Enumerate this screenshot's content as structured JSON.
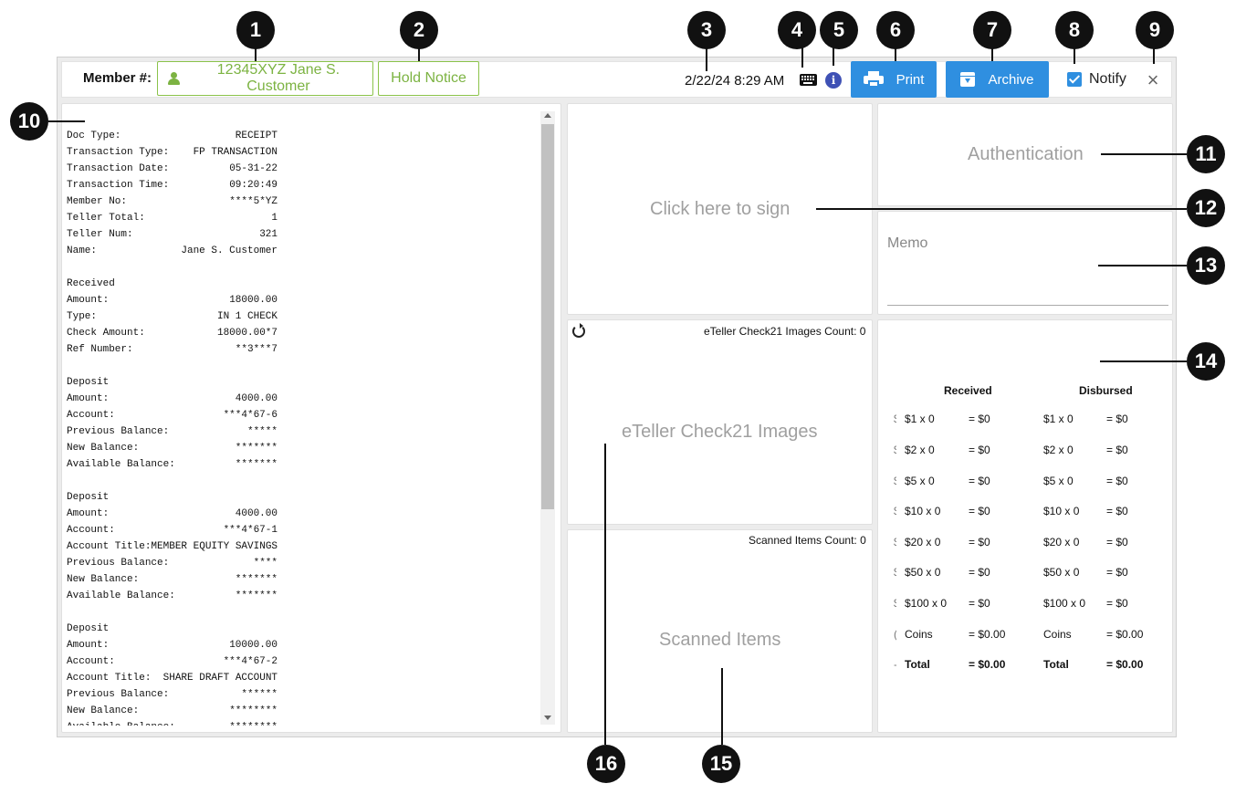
{
  "header": {
    "member_label": "Member #:",
    "member_value": "12345XYZ Jane S. Customer",
    "hold_notice": "Hold Notice",
    "datetime": "2/22/24 8:29 AM",
    "print_label": "Print",
    "archive_label": "Archive",
    "notify_label": "Notify",
    "notify_checked": true,
    "close_glyph": "×",
    "info_glyph": "i"
  },
  "receipt": {
    "lines": [
      [
        "Doc Type:",
        "RECEIPT"
      ],
      [
        "Transaction Type:",
        "FP TRANSACTION"
      ],
      [
        "Transaction Date:",
        "05-31-22"
      ],
      [
        "Transaction Time:",
        "09:20:49"
      ],
      [
        "Member No:",
        "****5*YZ"
      ],
      [
        "Teller Total:",
        "1"
      ],
      [
        "Teller Num:",
        "321"
      ],
      [
        "Name:",
        "Jane S. Customer"
      ],
      [
        "",
        ""
      ],
      [
        "Received",
        ""
      ],
      [
        "Amount:",
        "18000.00"
      ],
      [
        "Type:",
        "IN 1 CHECK"
      ],
      [
        "Check Amount:",
        "18000.00*7"
      ],
      [
        "Ref Number:",
        "**3***7"
      ],
      [
        "",
        ""
      ],
      [
        "Deposit",
        ""
      ],
      [
        "Amount:",
        "4000.00"
      ],
      [
        "Account:",
        "***4*67-6"
      ],
      [
        "Previous Balance:",
        "*****"
      ],
      [
        "New Balance:",
        "*******"
      ],
      [
        "Available Balance:",
        "*******"
      ],
      [
        "",
        ""
      ],
      [
        "Deposit",
        ""
      ],
      [
        "Amount:",
        "4000.00"
      ],
      [
        "Account:",
        "***4*67-1"
      ],
      [
        "Account Title:MEMBER EQUITY SAVINGS",
        ""
      ],
      [
        "Previous Balance:",
        "****"
      ],
      [
        "New Balance:",
        "*******"
      ],
      [
        "Available Balance:",
        "*******"
      ],
      [
        "",
        ""
      ],
      [
        "Deposit",
        ""
      ],
      [
        "Amount:",
        "10000.00"
      ],
      [
        "Account:",
        "***4*67-2"
      ],
      [
        "Account Title:  SHARE DRAFT ACCOUNT",
        ""
      ],
      [
        "Previous Balance:",
        "******"
      ],
      [
        "New Balance:",
        "********"
      ],
      [
        "Available Balance:",
        "********"
      ]
    ]
  },
  "sign": {
    "placeholder": "Click here to sign"
  },
  "auth": {
    "placeholder": "Authentication"
  },
  "memo": {
    "label": "Memo"
  },
  "check21": {
    "count_label": "eTeller Check21 Images Count: 0",
    "placeholder": "eTeller Check21 Images"
  },
  "scanned": {
    "count_label": "Scanned Items Count: 0",
    "placeholder": "Scanned Items"
  },
  "cash": {
    "received_header": "Received",
    "disbursed_header": "Disbursed",
    "rows": [
      {
        "edge": "$",
        "r_label": "$1 x 0",
        "r_value": "= $0",
        "d_label": "$1 x 0",
        "d_value": "= $0"
      },
      {
        "edge": "$",
        "r_label": "$2 x 0",
        "r_value": "= $0",
        "d_label": "$2 x 0",
        "d_value": "= $0"
      },
      {
        "edge": "$",
        "r_label": "$5 x 0",
        "r_value": "= $0",
        "d_label": "$5 x 0",
        "d_value": "= $0"
      },
      {
        "edge": "$",
        "r_label": "$10 x 0",
        "r_value": "= $0",
        "d_label": "$10 x 0",
        "d_value": "= $0"
      },
      {
        "edge": "$",
        "r_label": "$20 x 0",
        "r_value": "= $0",
        "d_label": "$20 x 0",
        "d_value": "= $0"
      },
      {
        "edge": "$",
        "r_label": "$50 x 0",
        "r_value": "= $0",
        "d_label": "$50 x 0",
        "d_value": "= $0"
      },
      {
        "edge": "$",
        "r_label": "$100 x 0",
        "r_value": "= $0",
        "d_label": "$100 x 0",
        "d_value": "= $0"
      },
      {
        "edge": "(",
        "r_label": "Coins",
        "r_value": "= $0.00",
        "d_label": "Coins",
        "d_value": "= $0.00"
      },
      {
        "edge": "-",
        "r_label": "Total",
        "r_value": "= $0.00",
        "d_label": "Total",
        "d_value": "= $0.00",
        "bold": true
      }
    ]
  },
  "callouts": [
    "1",
    "2",
    "3",
    "4",
    "5",
    "6",
    "7",
    "8",
    "9",
    "10",
    "11",
    "12",
    "13",
    "14",
    "15",
    "16"
  ]
}
